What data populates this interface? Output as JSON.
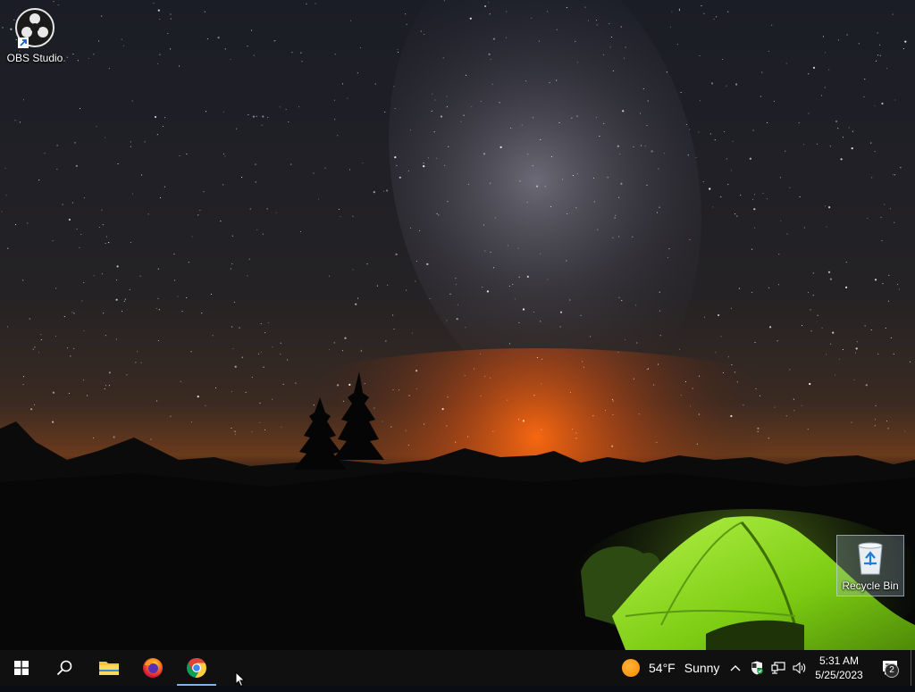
{
  "desktop": {
    "icons": [
      {
        "label": "OBS Studio"
      },
      {
        "label": "Recycle Bin"
      }
    ]
  },
  "taskbar": {
    "start_icon": "windows-logo-icon",
    "search_icon": "search-icon",
    "pinned": [
      {
        "name": "File Explorer",
        "icon": "folder-icon",
        "active": false
      },
      {
        "name": "Firefox",
        "icon": "firefox-icon",
        "active": false
      },
      {
        "name": "Google Chrome",
        "icon": "chrome-icon",
        "active": true
      }
    ],
    "weather": {
      "temp": "54°F",
      "condition": "Sunny",
      "icon": "sun-icon"
    },
    "tray": {
      "chevron_icon": "chevron-up-icon",
      "security_icon": "shield-icon",
      "network_icon": "network-icon",
      "volume_icon": "volume-icon"
    },
    "clock": {
      "time": "5:31 AM",
      "date": "5/25/2023"
    },
    "notifications": {
      "count": "2",
      "icon": "action-center-icon"
    }
  },
  "colors": {
    "taskbar_bg": "#101010",
    "active_indicator": "#7fb6e8",
    "tent_green": "#8edc1a",
    "horizon_glow": "#ff6a10"
  }
}
